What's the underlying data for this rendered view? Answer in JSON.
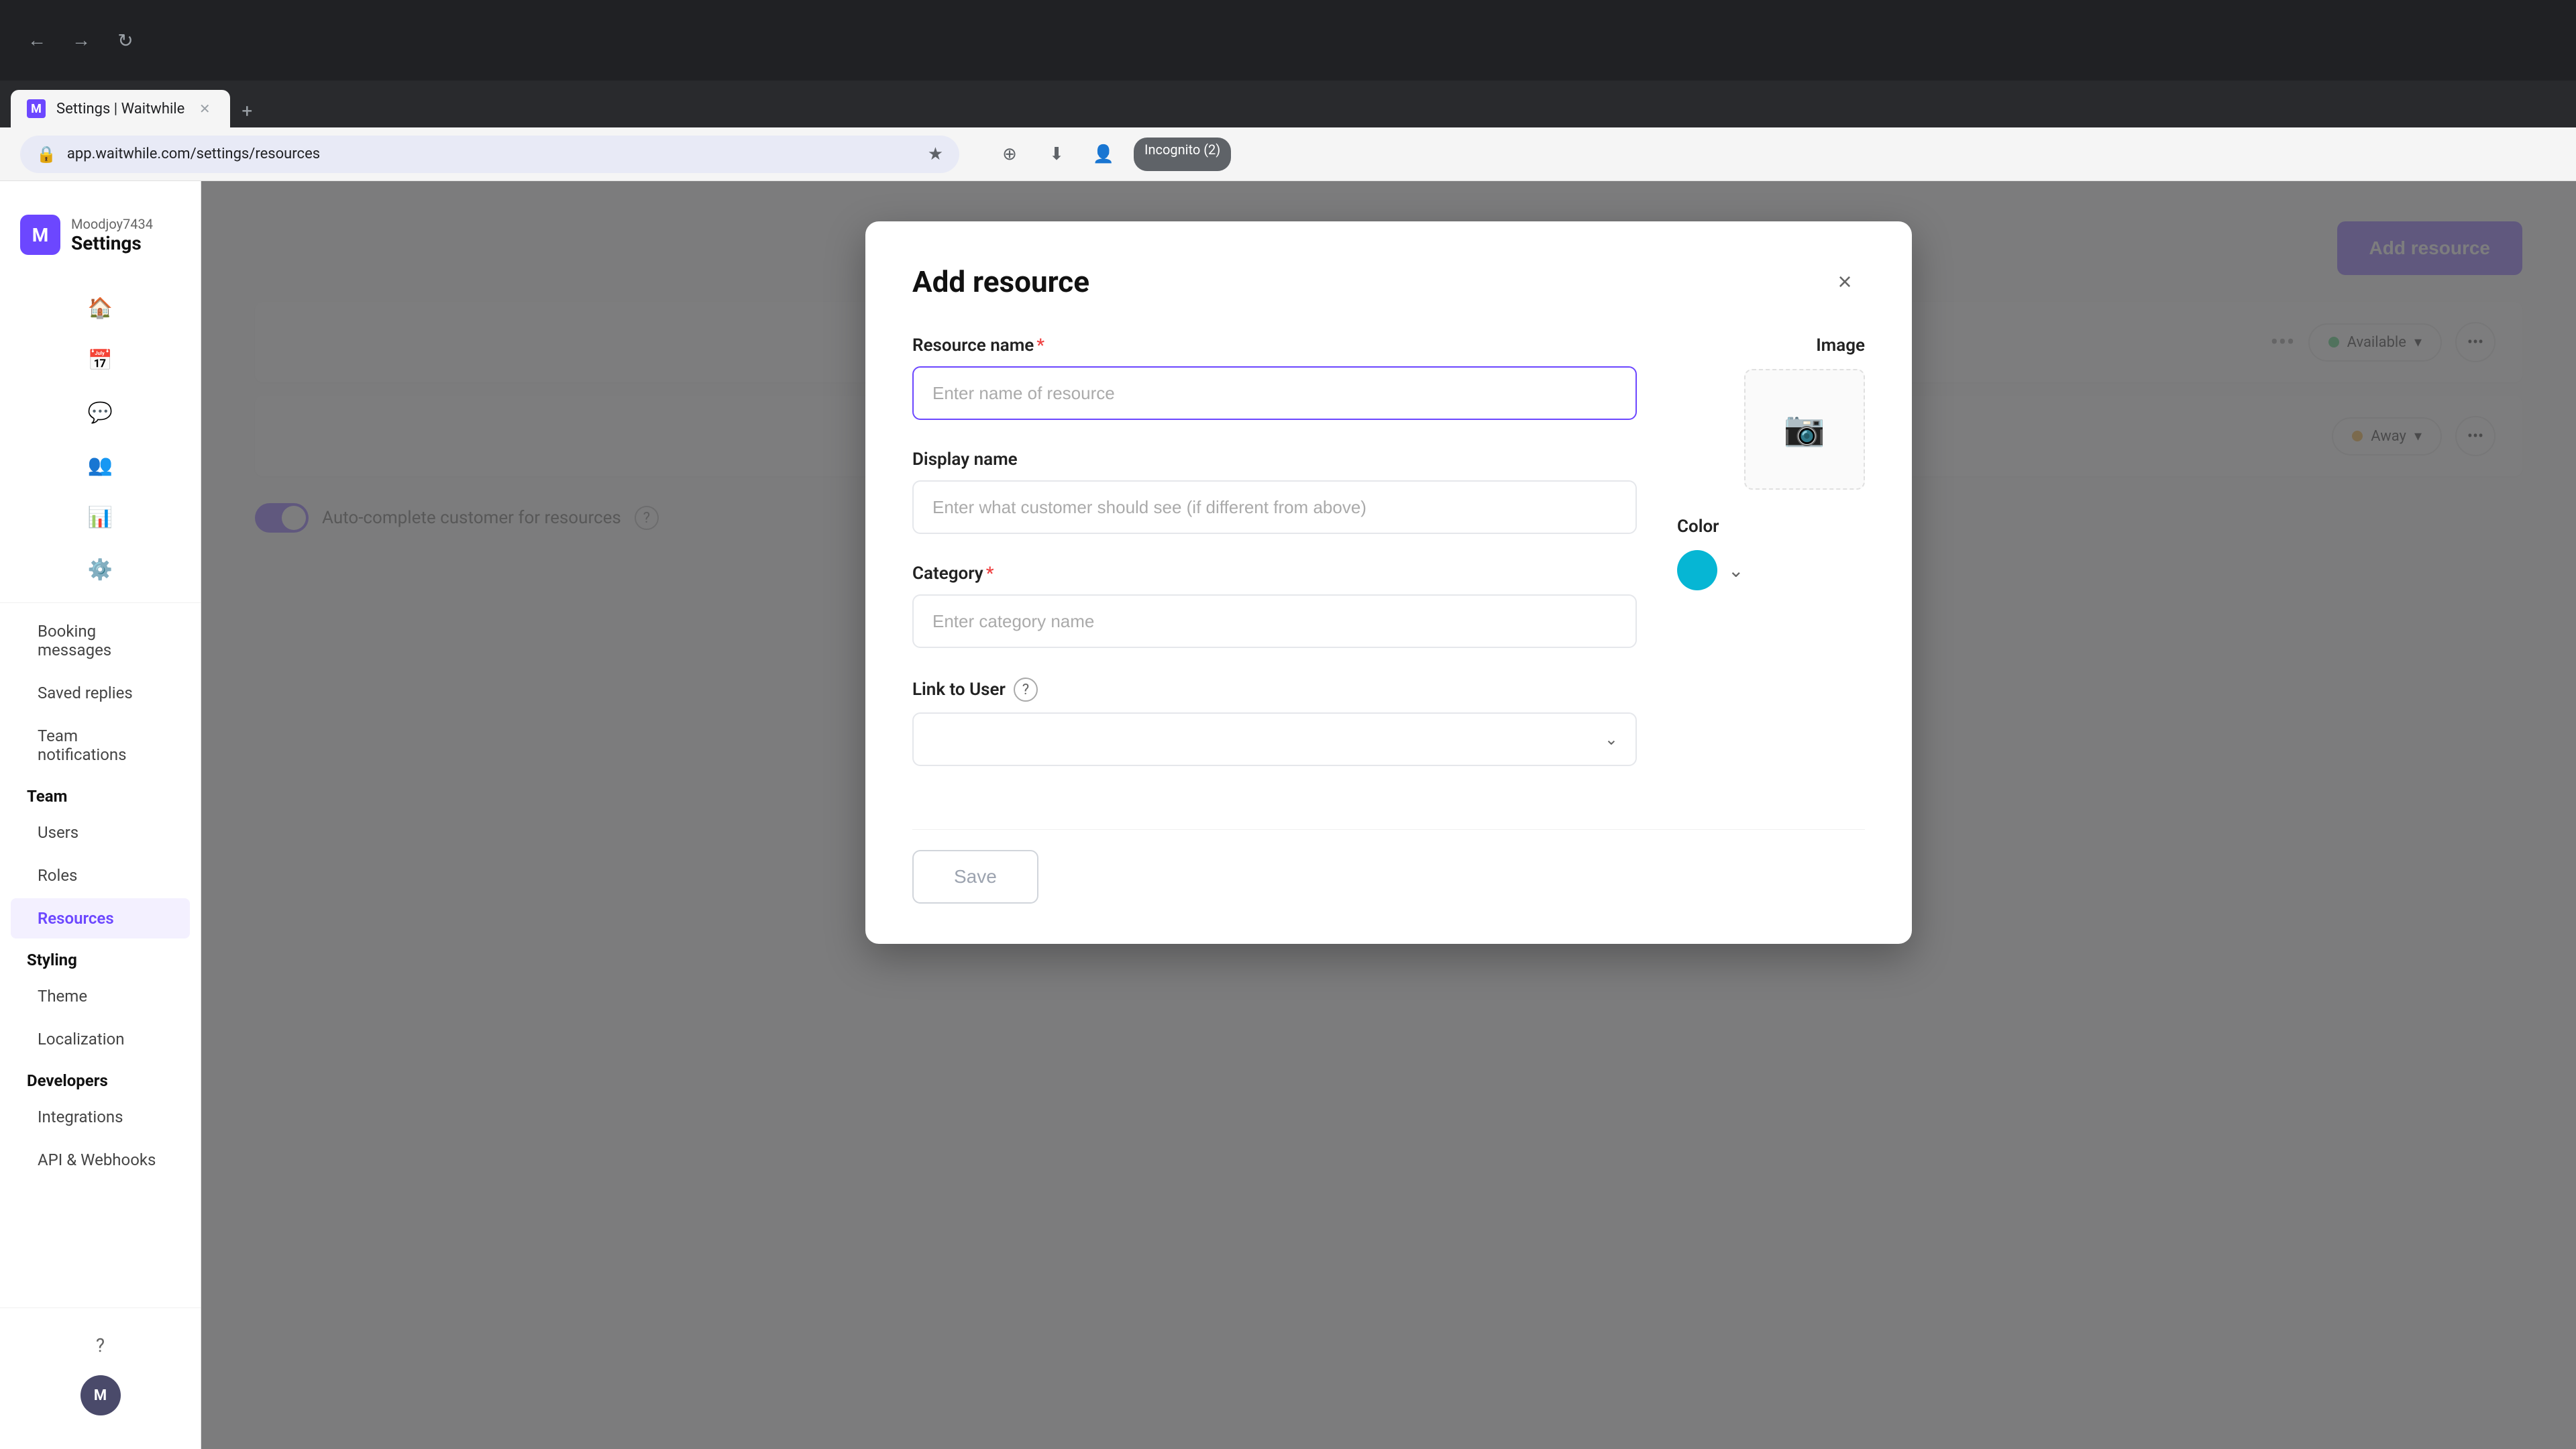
{
  "browser": {
    "tab_title": "Settings | Waitwhile",
    "url": "app.waitwhile.com/settings/resources",
    "favicon_letter": "M",
    "incognito_label": "Incognito (2)",
    "new_tab_symbol": "+"
  },
  "sidebar": {
    "username": "Moodjoy7434",
    "app_title": "Settings",
    "avatar_letter": "M",
    "nav_icons": [
      "🏠",
      "📅",
      "💬",
      "👤",
      "📊",
      "⚙️"
    ],
    "sections": [
      {
        "label": "",
        "items": [
          {
            "id": "booking-messages",
            "label": "Booking messages",
            "active": false
          },
          {
            "id": "saved-replies",
            "label": "Saved replies",
            "active": false
          },
          {
            "id": "team-notifications",
            "label": "Team notifications",
            "active": false
          }
        ]
      },
      {
        "label": "Team",
        "items": [
          {
            "id": "users",
            "label": "Users",
            "active": false
          },
          {
            "id": "roles",
            "label": "Roles",
            "active": false
          },
          {
            "id": "resources",
            "label": "Resources",
            "active": true
          }
        ]
      },
      {
        "label": "Styling",
        "items": [
          {
            "id": "theme",
            "label": "Theme",
            "active": false
          },
          {
            "id": "localization",
            "label": "Localization",
            "active": false
          }
        ]
      },
      {
        "label": "Developers",
        "items": [
          {
            "id": "integrations",
            "label": "Integrations",
            "active": false
          },
          {
            "id": "api-webhooks",
            "label": "API & Webhooks",
            "active": false
          }
        ]
      }
    ],
    "bottom_icons": [
      "?"
    ],
    "bottom_avatar_letter": "M"
  },
  "main": {
    "add_resource_button_label": "Add resource",
    "resources": [
      {
        "id": 1,
        "status": "Available",
        "status_type": "available"
      },
      {
        "id": 2,
        "status": "Away",
        "status_type": "away"
      }
    ],
    "autocomplete_label": "Auto-complete customer for resources",
    "autocomplete_help": "?"
  },
  "modal": {
    "title": "Add resource",
    "close_symbol": "×",
    "resource_name_label": "Resource name",
    "resource_name_required": "*",
    "resource_name_placeholder": "Enter name of resource",
    "display_name_label": "Display name",
    "display_name_placeholder": "Enter what customer should see (if different from above)",
    "category_label": "Category",
    "category_required": "*",
    "category_placeholder": "Enter category name",
    "link_to_user_label": "Link to User",
    "link_to_user_help": "?",
    "image_label": "Image",
    "color_label": "Color",
    "color_value": "#06b6d4",
    "save_button_label": "Save"
  }
}
